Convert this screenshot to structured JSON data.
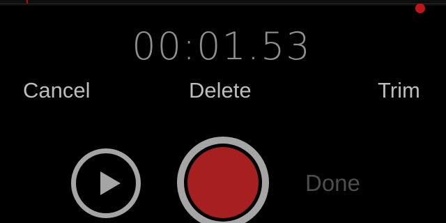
{
  "recorder": {
    "timer": "00:01.53",
    "state": "recording"
  },
  "actions": {
    "cancel_label": "Cancel",
    "delete_label": "Delete",
    "trim_label": "Trim"
  },
  "controls": {
    "play_icon": "play-icon",
    "record_icon": "record-icon",
    "done_label": "Done",
    "done_enabled": false
  },
  "colors": {
    "background": "#000000",
    "text": "#bdbdbd",
    "timer_text": "#8f8f8f",
    "disabled_text": "#4d4d4d",
    "ring": "#a5a5a5",
    "record_red": "#a5201f",
    "playhead_red": "#c0141a"
  }
}
